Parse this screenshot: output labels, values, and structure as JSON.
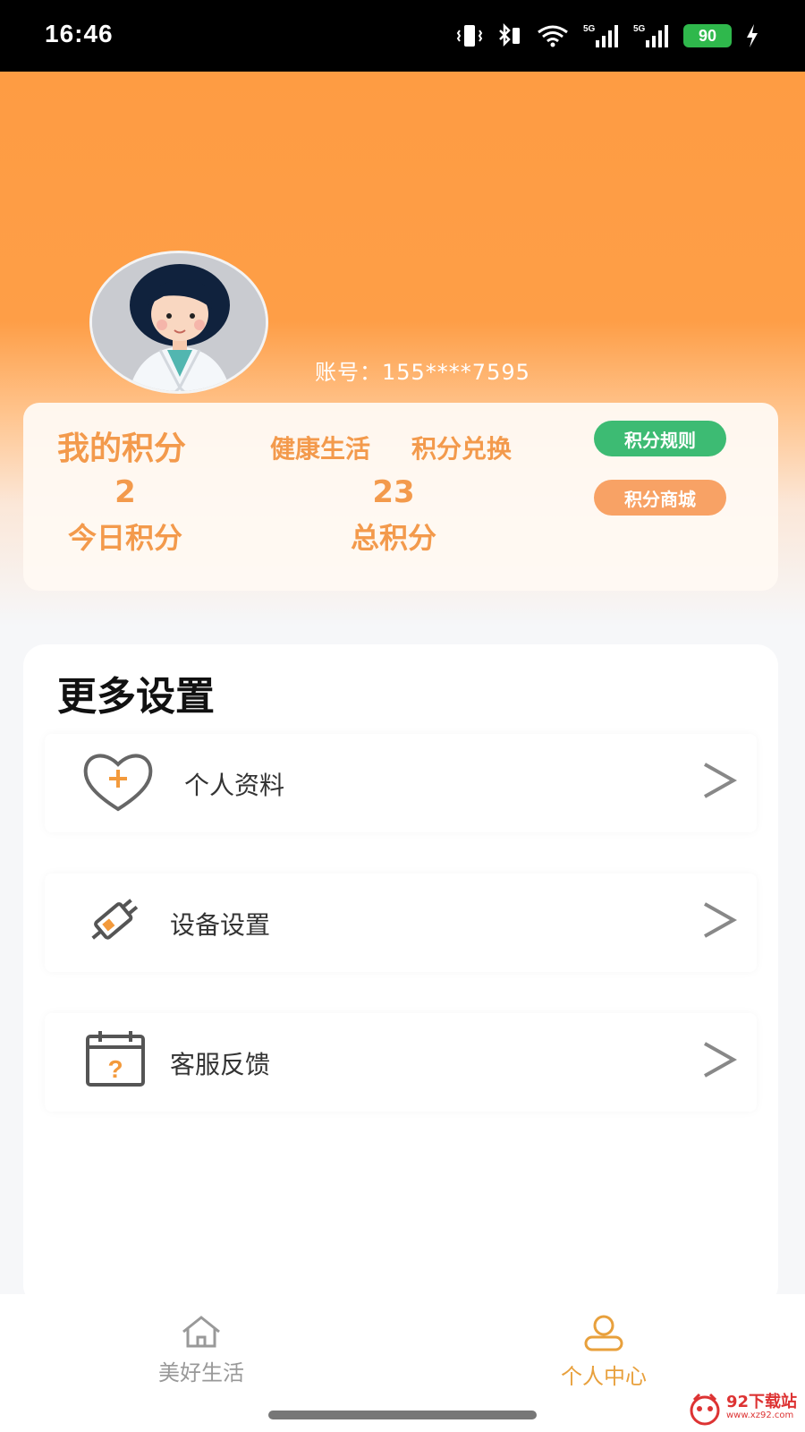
{
  "status_bar": {
    "time": "16:46",
    "network_1": "5G",
    "network_2": "5G",
    "battery": "90"
  },
  "profile": {
    "account": "账号：155****7595"
  },
  "points": {
    "title": "我的积分",
    "link_health": "健康生活",
    "link_exchange": "积分兑换",
    "rules_button": "积分规则",
    "mall_button": "积分商城",
    "today_value": "2",
    "today_label": "今日积分",
    "total_value": "23",
    "total_label": "总积分"
  },
  "settings": {
    "title": "更多设置",
    "items": [
      {
        "label": "个人资料",
        "icon": "heart-plus-icon"
      },
      {
        "label": "设备设置",
        "icon": "device-plug-icon"
      },
      {
        "label": "客服反馈",
        "icon": "calendar-question-icon"
      }
    ]
  },
  "nav": {
    "items": [
      {
        "label": "美好生活",
        "icon": "home-icon",
        "active": false
      },
      {
        "label": "个人中心",
        "icon": "user-icon",
        "active": true
      }
    ]
  },
  "colors": {
    "accent": "#fe9c43",
    "points_text": "#f39a4c",
    "green": "#3dbb73",
    "nav_active": "#e8a03c",
    "nav_inactive": "#999999"
  },
  "watermark": {
    "text": "92下载站",
    "url": "www.xz92.com"
  }
}
